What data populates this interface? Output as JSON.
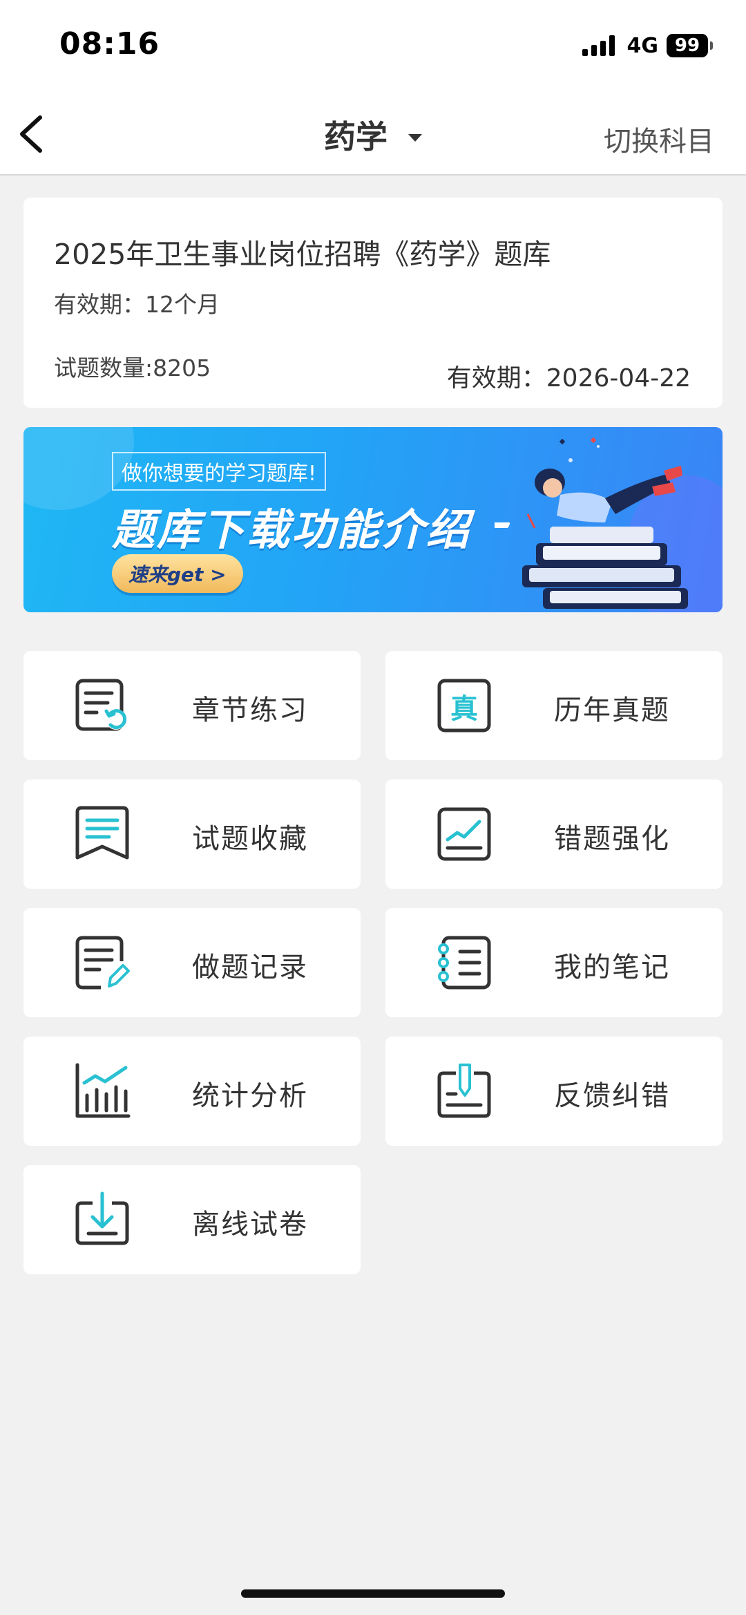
{
  "status_bar": {
    "time": "08:16",
    "network": "4G",
    "battery": "99"
  },
  "nav": {
    "title": "药学",
    "switch_label": "切换科目"
  },
  "exam_card": {
    "title": "2025年卫生事业岗位招聘《药学》题库",
    "validity": "有效期：12个月",
    "question_count": "试题数量:8205",
    "expire": "有效期：2026-04-22"
  },
  "banner": {
    "tagline": "做你想要的学习题库!",
    "headline": "题库下载功能介绍",
    "cta": "速来get >"
  },
  "menu": [
    {
      "label": "章节练习",
      "icon": "chapter-practice-icon"
    },
    {
      "label": "历年真题",
      "icon": "past-exams-icon"
    },
    {
      "label": "试题收藏",
      "icon": "bookmark-icon"
    },
    {
      "label": "错题强化",
      "icon": "mistakes-chart-icon"
    },
    {
      "label": "做题记录",
      "icon": "record-edit-icon"
    },
    {
      "label": "我的笔记",
      "icon": "notebook-icon"
    },
    {
      "label": "统计分析",
      "icon": "statistics-icon"
    },
    {
      "label": "反馈纠错",
      "icon": "feedback-icon"
    },
    {
      "label": "离线试卷",
      "icon": "download-icon"
    }
  ],
  "colors": {
    "accent": "#29c1d2",
    "icon_dark": "#333333",
    "banner": "#23a3f6"
  }
}
